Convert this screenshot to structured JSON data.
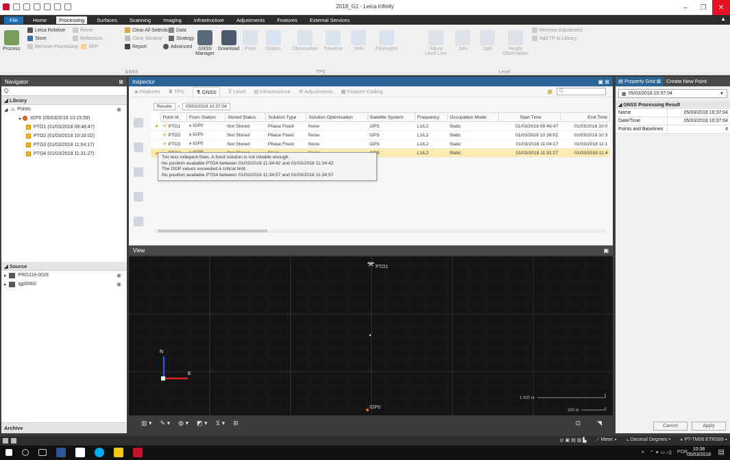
{
  "window": {
    "title": "2018_G1 - Leica Infinity"
  },
  "ribbon_tabs": [
    "File",
    "Home",
    "Processing",
    "Surfaces",
    "Scanning",
    "Imaging",
    "Infrastructure",
    "Adjustments",
    "Features",
    "External Services"
  ],
  "ribbon": {
    "process_label": "Process",
    "gnss": {
      "leica_relative": "Leica Relative",
      "store": "Store",
      "remove_processing": "Remove Processing",
      "rover": "Rover",
      "reference": "Reference",
      "spp": "SPP",
      "clear_all_selections": "Clear All Selections",
      "clear_window": "Clear Window",
      "report": "Report",
      "data": "Data",
      "strategy": "Strategy",
      "advanced": "Advanced",
      "gnss_manager": "GNSS Manager",
      "download": "Download",
      "group_label": "GNSS"
    },
    "tps": {
      "point": "Point",
      "station": "Station",
      "observation": "Observation",
      "traverse": "Traverse",
      "sets": "Sets",
      "foresights": "Foresights",
      "group_label": "TPS"
    },
    "level": {
      "adjust_level_line": "Adjust Level Line",
      "join": "Join",
      "split": "Split",
      "height_observation": "Height Observation",
      "remove_adjustment": "Remove Adjustment",
      "add_tp_to_library": "Add TP to Library",
      "group_label": "Level"
    }
  },
  "navigator": {
    "title": "Navigator",
    "search_placeholder": "Q",
    "library_label": "Library",
    "points_label": "Points",
    "points": [
      "IGP0 (05/03/2018 10:15:59)",
      "PTO1 (01/03/2018 09:48:47)",
      "PTO2 (01/03/2018 10:16:02)",
      "PTO3 (01/03/2018 11:04:17)",
      "PTO4 (01/03/2018 11:31:27)"
    ],
    "source_label": "Source",
    "sources": [
      "PROJ18-0029",
      "igp0060i"
    ],
    "archive_label": "Archive"
  },
  "inspector": {
    "title": "Inspector",
    "tabs": [
      "Features",
      "TPS",
      "GNSS",
      "Level",
      "Infrastructure",
      "Adjustments",
      "Feature Coding"
    ],
    "search_placeholder": "Q",
    "breadcrumb": [
      "Results",
      "05/03/2018 10:37:04"
    ],
    "columns": [
      "Point Id",
      "From Station",
      "Stored Status",
      "Solution Type",
      "Solution Optimisation",
      "Satellite System",
      "Frequency",
      "Occupation Mode",
      "Start Time",
      "End Time"
    ],
    "rows": [
      {
        "warn": "▲",
        "point_id": "PTO1",
        "from_station": "IGP0",
        "stored_status": "Not Stored",
        "solution_type": "Phase Fixed",
        "optimisation": "None",
        "satellite": "GPS",
        "frequency": "L1/L2",
        "occupation": "Static",
        "start": "01/03/2018 09:48:47",
        "end": "01/03/2018 10:0"
      },
      {
        "warn": "",
        "point_id": "PTO2",
        "from_station": "IGP0",
        "stored_status": "Not Stored",
        "solution_type": "Phase Fixed",
        "optimisation": "None",
        "satellite": "GPS",
        "frequency": "L1/L2",
        "occupation": "Static",
        "start": "01/03/2018 10:16:02",
        "end": "01/03/2018 10:3"
      },
      {
        "warn": "",
        "point_id": "PTO3",
        "from_station": "IGP0",
        "stored_status": "Not Stored",
        "solution_type": "Phase Fixed",
        "optimisation": "None",
        "satellite": "GPS",
        "frequency": "L1/L2",
        "occupation": "Static",
        "start": "01/03/2018 11:04:17",
        "end": "01/03/2018 11:1"
      },
      {
        "warn": "▲",
        "point_id": "PTO4",
        "from_station": "IGP0",
        "stored_status": "Not Stored",
        "solution_type": "Float",
        "optimisation": "None",
        "satellite": "GPS",
        "frequency": "L1/L2",
        "occupation": "Static",
        "start": "01/03/2018 11:31:27",
        "end": "01/03/2018 11:4"
      }
    ],
    "tooltip_lines": [
      "Too less indepent fixes. A fixed solution is not reliable enough.",
      "No position available PTO4 between 01/03/2018 11:34:42 and 01/03/2018 11:34:42",
      "The DOP values exceeded a critical limit.",
      "No position available PTO4 between 01/03/2018 11:34:57 and 01/03/2018 11:34:57"
    ]
  },
  "view": {
    "title": "View",
    "labels": {
      "pto1": "PTO1",
      "igp0": "IGP0",
      "north": "N",
      "east": "E",
      "scale_1000": "1 000 m",
      "scale_200": "200 m"
    }
  },
  "property_grid": {
    "tab_property_grid": "Property Grid",
    "tab_create_new_point": "Create New Point",
    "selected": "05/03/2018 10:37:04",
    "section": "GNSS Processing Result",
    "rows": [
      {
        "k": "Name",
        "v": "05/03/2018 10:37:04"
      },
      {
        "k": "Date/Time",
        "v": "05/03/2018 10:37:04"
      },
      {
        "k": "Points and Baselines",
        "v": "4"
      }
    ],
    "cancel": "Cancel",
    "apply": "Apply"
  },
  "statusbar": {
    "units": "Meter",
    "angles": "Decimal Degrees",
    "crs": "PT-TM06 ETRS89"
  },
  "taskbar": {
    "time": "10:38",
    "date": "05/03/2018",
    "lang": "POR"
  }
}
